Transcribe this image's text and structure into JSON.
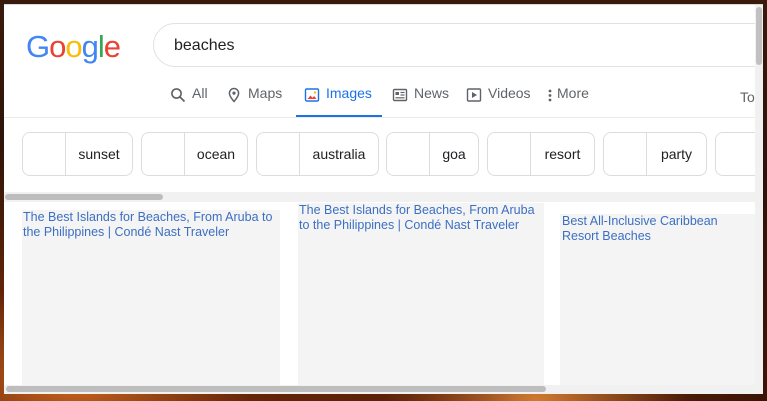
{
  "logo": {
    "letters": [
      "G",
      "o",
      "o",
      "g",
      "l",
      "e"
    ],
    "colors": [
      "#4285F4",
      "#EA4335",
      "#FBBC05",
      "#4285F4",
      "#34A853",
      "#EA4335"
    ]
  },
  "search": {
    "value": "beaches"
  },
  "tabs": [
    {
      "label": "All",
      "icon": "search-icon",
      "active": false
    },
    {
      "label": "Maps",
      "icon": "map-pin-icon",
      "active": false
    },
    {
      "label": "Images",
      "icon": "image-icon",
      "active": true
    },
    {
      "label": "News",
      "icon": "news-icon",
      "active": false
    },
    {
      "label": "Videos",
      "icon": "play-icon",
      "active": false
    },
    {
      "label": "More",
      "icon": "more-vert-icon",
      "active": false
    }
  ],
  "tools_partial": "To",
  "chips": [
    "sunset",
    "ocean",
    "australia",
    "goa",
    "resort",
    "party"
  ],
  "results": [
    {
      "title": "The Best Islands for Beaches, From Aruba to the Philippines | Condé Nast Traveler"
    },
    {
      "title": "The Best Islands for Beaches, From Aruba to the Philippines | Condé Nast Traveler"
    },
    {
      "title": "Best All-Inclusive Caribbean Resort Beaches"
    }
  ],
  "colors": {
    "accent": "#1a73e8",
    "link": "#3c6fc2"
  }
}
